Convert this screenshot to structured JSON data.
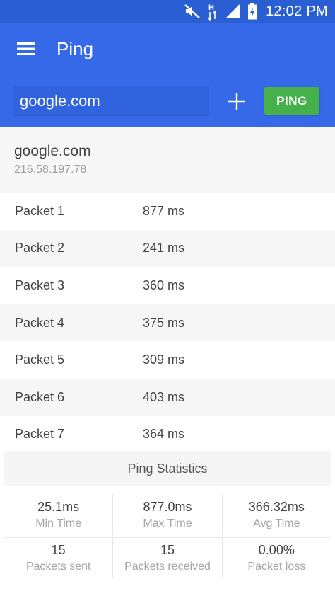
{
  "status_bar": {
    "time": "12:02 PM",
    "network_label": "H"
  },
  "app_bar": {
    "title": "Ping",
    "host_input_value": "google.com",
    "ping_button_label": "PING",
    "background_color": "#3569e7",
    "ping_button_color": "#46b04a"
  },
  "host": {
    "name": "google.com",
    "ip": "216.58.197.78"
  },
  "packets": [
    {
      "label": "Packet 1",
      "value": "877 ms"
    },
    {
      "label": "Packet 2",
      "value": "241 ms"
    },
    {
      "label": "Packet 3",
      "value": "360 ms"
    },
    {
      "label": "Packet 4",
      "value": "375 ms"
    },
    {
      "label": "Packet 5",
      "value": "309 ms"
    },
    {
      "label": "Packet 6",
      "value": "403 ms"
    },
    {
      "label": "Packet 7",
      "value": "364 ms"
    }
  ],
  "statistics": {
    "title": "Ping Statistics",
    "min_time": {
      "value": "25.1ms",
      "label": "Min Time"
    },
    "max_time": {
      "value": "877.0ms",
      "label": "Max Time"
    },
    "avg_time": {
      "value": "366.32ms",
      "label": "Avg Time"
    },
    "packets_sent": {
      "value": "15",
      "label": "Packets sent"
    },
    "packets_received": {
      "value": "15",
      "label": "Packets received"
    },
    "packet_loss": {
      "value": "0.00%",
      "label": "Packet loss"
    }
  }
}
